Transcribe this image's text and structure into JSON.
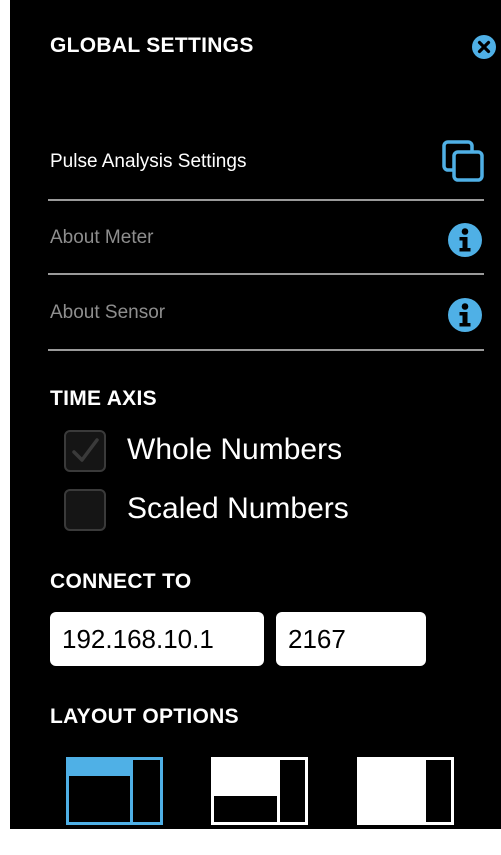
{
  "header": {
    "title": "GLOBAL SETTINGS",
    "close_icon": "close-circle-icon"
  },
  "menu": [
    {
      "label": "Pulse Analysis Settings",
      "icon": "copy-windows-icon",
      "enabled": true
    },
    {
      "label": "About Meter",
      "icon": "info-icon",
      "enabled": false
    },
    {
      "label": "About Sensor",
      "icon": "info-icon",
      "enabled": false
    }
  ],
  "time_axis": {
    "heading": "TIME AXIS",
    "options": [
      {
        "label": "Whole Numbers",
        "checked": true
      },
      {
        "label": "Scaled Numbers",
        "checked": false
      }
    ]
  },
  "connect": {
    "heading": "CONNECT TO",
    "ip_value": "192.168.10.1",
    "port_value": "2167"
  },
  "layout": {
    "heading": "LAYOUT OPTIONS",
    "options": [
      "layout-top-wide-icon",
      "layout-bottom-wide-icon",
      "layout-full-side-icon"
    ],
    "selected": 0
  },
  "colors": {
    "background": "#000000",
    "accent": "#4fb0e6",
    "text": "#ffffff",
    "muted_text": "#8e8e8e",
    "divider": "#9a9a9a"
  }
}
